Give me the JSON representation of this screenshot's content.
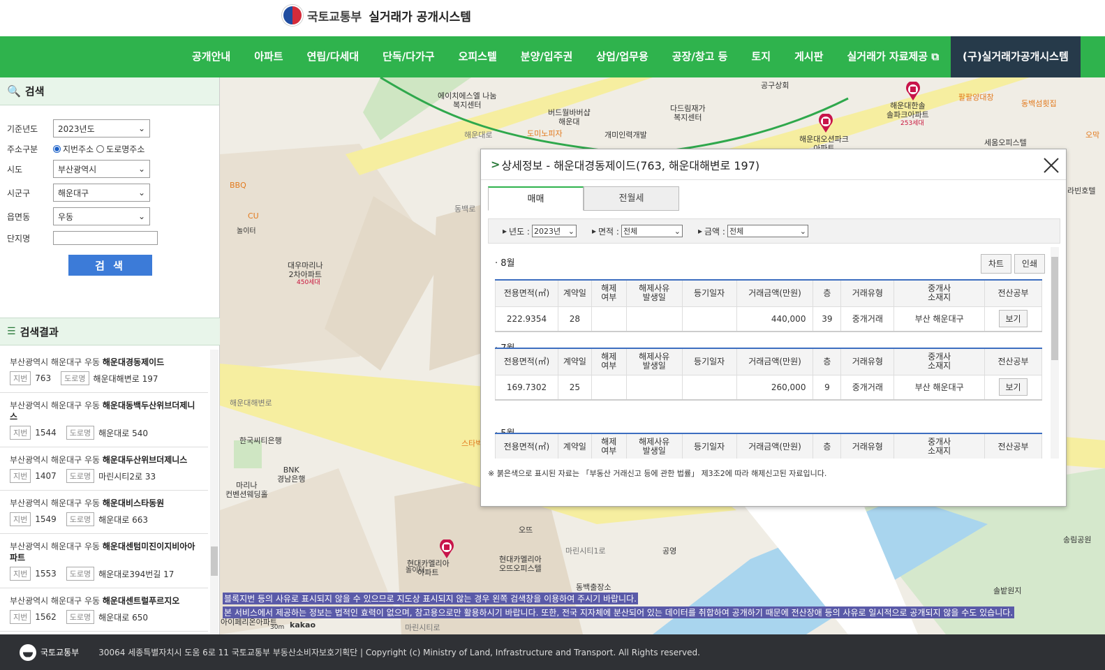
{
  "header": {
    "org": "국토교통부",
    "system": "실거래가 공개시스템"
  },
  "nav": [
    "공개안내",
    "아파트",
    "연립/다세대",
    "단독/다가구",
    "오피스텔",
    "분양/입주권",
    "상업/업무용",
    "공장/창고 등",
    "토지",
    "게시판",
    "실거래가 자료제공",
    "(구)실거래가공개시스템"
  ],
  "search": {
    "title": "검색",
    "year_label": "기준년도",
    "year_value": "2023년도",
    "addr_label": "주소구분",
    "addr_opt1": "지번주소",
    "addr_opt2": "도로명주소",
    "sido_label": "시도",
    "sido_value": "부산광역시",
    "sigungu_label": "시군구",
    "sigungu_value": "해운대구",
    "dong_label": "읍면동",
    "dong_value": "우동",
    "complex_label": "단지명",
    "complex_value": "",
    "button": "검 색"
  },
  "results": {
    "title": "검색결과",
    "jibun_tag": "지번",
    "road_tag": "도로명",
    "items": [
      {
        "prefix": "부산광역시 해운대구 우동 ",
        "name": "해운대경동제이드",
        "jibun": "763",
        "road": "해운대해변로 197"
      },
      {
        "prefix": "부산광역시 해운대구 우동 ",
        "name": "해운대동백두산위브더제니스",
        "jibun": "1544",
        "road": "해운대로 540"
      },
      {
        "prefix": "부산광역시 해운대구 우동 ",
        "name": "해운대두산위브더제니스",
        "jibun": "1407",
        "road": "마린시티2로 33"
      },
      {
        "prefix": "부산광역시 해운대구 우동 ",
        "name": "해운대비스타동원",
        "jibun": "1549",
        "road": "해운대로 663"
      },
      {
        "prefix": "부산광역시 해운대구 우동 ",
        "name": "해운대센텀미진이지비아아파트",
        "jibun": "1553",
        "road": "해운대로394번길 17"
      },
      {
        "prefix": "부산광역시 해운대구 우동 ",
        "name": "해운대센트럴푸르지오",
        "jibun": "1562",
        "road": "해운대로 650"
      }
    ]
  },
  "map": {
    "labels": {
      "l1": "에이치에스엘 나눔\n복지센터",
      "l2": "버드월바버샵\n해운대",
      "l3": "도미노피자",
      "l4": "개미인력개발",
      "l5": "다드림재가\n복지센터",
      "l6": "공구상회",
      "l7": "해운대한솔\n솔파크아파트",
      "l8": "253세대",
      "l9": "해운대오션파크\n아파트",
      "l10": "팔팔양대창",
      "l11": "동백섬횟집",
      "l12": "세움오피스텔",
      "l13": "BBQ",
      "l14": "CU",
      "l15": "놀이터",
      "l16": "대우마리나\n2차아파트",
      "l17": "450세대",
      "l18": "해운대해변로",
      "l19": "한국씨티은행",
      "l20": "BNK\n경남은행",
      "l21": "마리나\n컨벤션웨딩홀",
      "l22": "현대카멜리아\n아파트",
      "l23": "현대카멜리아\n오뜨오피스텔",
      "l24": "동백출장소",
      "l25": "공영",
      "l26": "송림공원",
      "l27": "솔밭원지",
      "l28": "라빈호텔",
      "l29": "오뜨",
      "l30": "스타벅",
      "l31": "해운대로",
      "l32": "동백로",
      "l33": "오막",
      "l34": "놀이터",
      "l35": "마린시티1로",
      "l36": "아이페리온아파트",
      "l37": "30m",
      "l38": "kakao",
      "l39": "마린시티로"
    },
    "notice1": "블록지번 등의 사유로 표시되지 않을 수 있으므로 지도상 표시되지 않는 경우 왼쪽 검색창을 이용하여 주시기 바랍니다.",
    "notice2": "본 서비스에서 제공하는 정보는 법적인 효력이 없으며, 참고용으로만 활용하시기 바랍니다. 또한, 전국 지자체에 분산되어 있는 데이터를 취합하여 공개하기 때문에 전산장애 등의 사유로 일시적으로 공개되지 않을 수도 있습니다."
  },
  "dialog": {
    "title": "상세정보 - 해운대경동제이드(763, 해운대해변로 197)",
    "tab_sale": "매매",
    "tab_rent": "전월세",
    "f_year_label": "년도 :",
    "f_year": "2023년",
    "f_area_label": "면적 :",
    "f_area": "전체",
    "f_price_label": "금액 :",
    "f_price": "전체",
    "chart_btn": "차트",
    "print_btn": "인쇄",
    "headers": [
      "전용면적(㎡)",
      "계약일",
      "해제\n여부",
      "해제사유\n발생일",
      "등기일자",
      "거래금액(만원)",
      "층",
      "거래유형",
      "중개사\n소재지",
      "전산공부"
    ],
    "months": [
      {
        "title": "8월",
        "row": {
          "area": "222.9354",
          "day": "28",
          "cancel": "",
          "cancel_date": "",
          "reg": "",
          "price": "440,000",
          "floor": "39",
          "type": "중개거래",
          "agent": "부산 해운대구",
          "view": "보기"
        }
      },
      {
        "title": "7월",
        "row": {
          "area": "169.7302",
          "day": "25",
          "cancel": "",
          "cancel_date": "",
          "reg": "",
          "price": "260,000",
          "floor": "9",
          "type": "중개거래",
          "agent": "부산 해운대구",
          "view": "보기"
        }
      },
      {
        "title": "5월"
      }
    ],
    "footnote": "※ 붉은색으로 표시된 자료는 「부동산 거래신고 등에 관한 법률」 제3조2에 따라 해제신고된 자료입니다."
  },
  "footer": {
    "org": "국토교통부",
    "address": "30064 세종특별자치시 도움 6로 11 국토교통부 부동산소비자보호기획단  |  Copyright (c) Ministry of Land, Infrastructure and Transport. All Rights reserved."
  }
}
